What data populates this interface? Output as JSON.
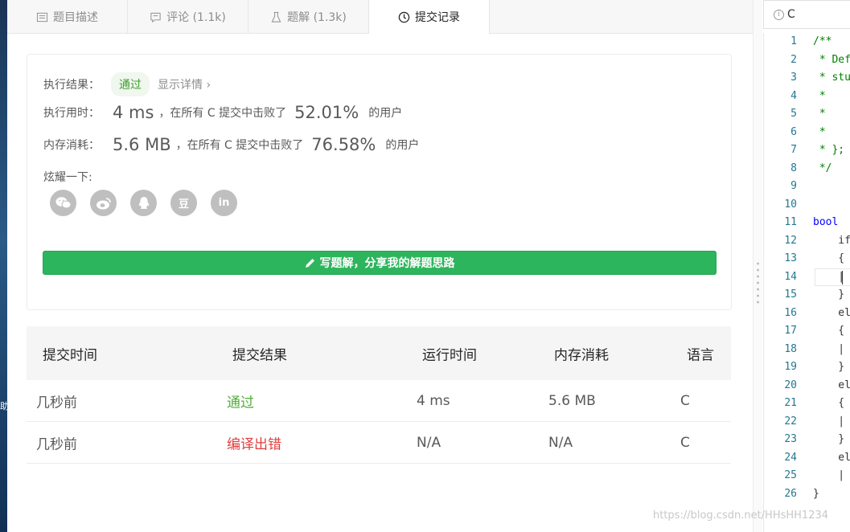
{
  "tabs": [
    {
      "label": "题目描述",
      "icon": "description-icon"
    },
    {
      "label": "评论 (1.1k)",
      "icon": "comment-icon"
    },
    {
      "label": "题解 (1.3k)",
      "icon": "flask-icon"
    },
    {
      "label": "提交记录",
      "icon": "clock-icon"
    }
  ],
  "result": {
    "label": "执行结果：",
    "status": "通过",
    "detail_link": "显示详情 ›"
  },
  "runtime": {
    "label": "执行用时：",
    "value": "4 ms",
    "middle": "，在所有 C 提交中击败了",
    "percent": "52.01%",
    "suffix": "的用户"
  },
  "memory": {
    "label": "内存消耗：",
    "value": "5.6 MB",
    "middle": "，在所有 C 提交中击败了",
    "percent": "76.58%",
    "suffix": "的用户"
  },
  "share": {
    "label": "炫耀一下:",
    "icons": [
      "wechat-icon",
      "weibo-icon",
      "qq-icon",
      "douban-icon",
      "linkedin-icon"
    ],
    "douban_glyph": "豆",
    "linkedin_glyph": "in"
  },
  "write_button": "写题解，分享我的解题思路",
  "table": {
    "headers": [
      "提交时间",
      "提交结果",
      "运行时间",
      "内存消耗",
      "语言"
    ],
    "rows": [
      {
        "time": "几秒前",
        "result": "通过",
        "runtime": "4 ms",
        "memory": "5.6 MB",
        "lang": "C"
      },
      {
        "time": "几秒前",
        "result": "编译出错",
        "runtime": "N/A",
        "memory": "N/A",
        "lang": "C"
      }
    ]
  },
  "editor": {
    "language": "C",
    "line_numbers": [
      "1",
      "2",
      "3",
      "4",
      "5",
      "6",
      "7",
      "8",
      "9",
      "10",
      "11",
      "12",
      "13",
      "14",
      "15",
      "16",
      "17",
      "18",
      "19",
      "20",
      "21",
      "22",
      "23",
      "24",
      "25",
      "26"
    ],
    "lines": [
      "/**",
      " * Def",
      " * stu",
      " *",
      " *",
      " *",
      " * };",
      " */",
      "",
      "",
      "bool ",
      "    if",
      "    {",
      "    |",
      "    }",
      "    el",
      "    {",
      "    |",
      "    }",
      "    el",
      "    {",
      "    |",
      "    }",
      "    el",
      "    |",
      "}"
    ]
  },
  "left_strip_char": "助",
  "watermark": "https://blog.csdn.net/HHsHH1234",
  "colors": {
    "accent_green": "#2db55d",
    "pass": "#52ad3a",
    "fail": "#e23d3d"
  }
}
